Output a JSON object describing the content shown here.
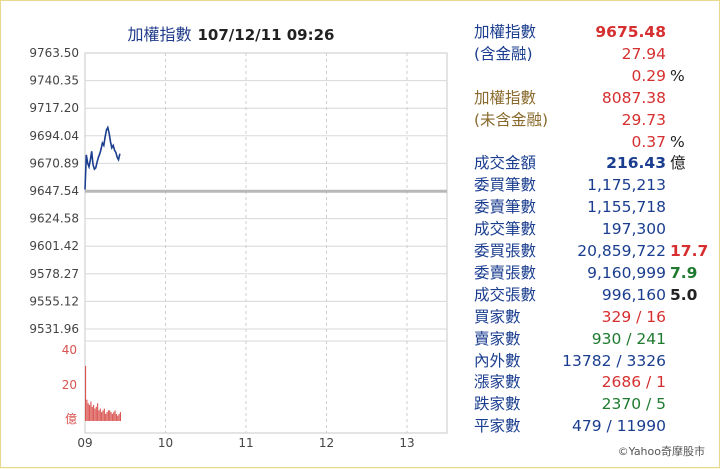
{
  "title": "加權指數",
  "datetime": "107/12/11 09:26",
  "copyright": "©Yahoo奇摩股市",
  "colors": {
    "line": "#1a3d8f",
    "ref": "#b8b8b8",
    "vol": "#d9534f",
    "red": "#d62f2f",
    "blue": "#1a3d8f",
    "green": "#1e7a2e",
    "brown": "#8a6a2c"
  },
  "yaxis": [
    "9763.50",
    "9740.35",
    "9717.20",
    "9694.04",
    "9670.89",
    "9647.54",
    "9624.58",
    "9601.42",
    "9578.27",
    "9555.12",
    "9531.96"
  ],
  "vol_axis": [
    "40",
    "20",
    "億"
  ],
  "xaxis": [
    "09",
    "10",
    "11",
    "12",
    "13"
  ],
  "stats": [
    {
      "label": "加權指數",
      "value": "9675.48",
      "suffix": "",
      "label_color": "#1a3d8f",
      "value_color": "#d62f2f",
      "bold": true
    },
    {
      "label": "(含金融)",
      "value": "27.94",
      "suffix": "",
      "label_color": "#1a3d8f",
      "value_color": "#d62f2f",
      "bold": false
    },
    {
      "label": "",
      "value": "0.29",
      "suffix": "%",
      "label_color": "#1a3d8f",
      "value_color": "#d62f2f",
      "bold": false
    },
    {
      "label": "加權指數",
      "value": "8087.38",
      "suffix": "",
      "label_color": "#8a6a2c",
      "value_color": "#d62f2f",
      "bold": false
    },
    {
      "label": "(未含金融)",
      "value": "29.73",
      "suffix": "",
      "label_color": "#8a6a2c",
      "value_color": "#d62f2f",
      "bold": false
    },
    {
      "label": "",
      "value": "0.37",
      "suffix": "%",
      "label_color": "#8a6a2c",
      "value_color": "#d62f2f",
      "bold": false
    },
    {
      "label": "成交金額",
      "value": "216.43",
      "suffix": "億",
      "label_color": "#1a3d8f",
      "value_color": "#1a3d8f",
      "bold": true
    },
    {
      "label": "委買筆數",
      "value": "1,175,213",
      "suffix": "",
      "label_color": "#1a3d8f",
      "value_color": "#1a3d8f",
      "bold": false
    },
    {
      "label": "委賣筆數",
      "value": "1,155,718",
      "suffix": "",
      "label_color": "#1a3d8f",
      "value_color": "#1a3d8f",
      "bold": false
    },
    {
      "label": "成交筆數",
      "value": "197,300",
      "suffix": "",
      "label_color": "#1a3d8f",
      "value_color": "#1a3d8f",
      "bold": false
    },
    {
      "label": "委買張數",
      "value": "20,859,722",
      "suffix": "17.7",
      "label_color": "#1a3d8f",
      "value_color": "#1a3d8f",
      "suffix_color": "#d62f2f",
      "bold": false
    },
    {
      "label": "委賣張數",
      "value": "9,160,999",
      "suffix": "7.9",
      "label_color": "#1a3d8f",
      "value_color": "#1a3d8f",
      "suffix_color": "#1e7a2e",
      "bold": false
    },
    {
      "label": "成交張數",
      "value": "996,160",
      "suffix": "5.0",
      "label_color": "#1a3d8f",
      "value_color": "#1a3d8f",
      "suffix_color": "#222222",
      "bold": false
    },
    {
      "label": "買家數",
      "value": "329 / 16",
      "suffix": "",
      "label_color": "#1a3d8f",
      "value_color": "#d62f2f",
      "bold": false
    },
    {
      "label": "賣家數",
      "value": "930 / 241",
      "suffix": "",
      "label_color": "#1a3d8f",
      "value_color": "#1e7a2e",
      "bold": false
    },
    {
      "label": "內外數",
      "value": "13782 / 3326",
      "suffix": "",
      "label_color": "#1a3d8f",
      "value_color": "#1a3d8f",
      "bold": false
    },
    {
      "label": "漲家數",
      "value": "2686 / 1",
      "suffix": "",
      "label_color": "#1a3d8f",
      "value_color": "#d62f2f",
      "bold": false
    },
    {
      "label": "跌家數",
      "value": "2370 / 5",
      "suffix": "",
      "label_color": "#1a3d8f",
      "value_color": "#1e7a2e",
      "bold": false
    },
    {
      "label": "平家數",
      "value": "479 / 11990",
      "suffix": "",
      "label_color": "#1a3d8f",
      "value_color": "#1a3d8f",
      "bold": false
    }
  ],
  "chart_data": {
    "type": "line",
    "reference": 9647.54,
    "ylim": [
      9531.96,
      9763.5
    ],
    "x_start": "09:00",
    "x_end": "13:30",
    "x": [
      "09:00",
      "09:01",
      "09:02",
      "09:03",
      "09:04",
      "09:05",
      "09:06",
      "09:07",
      "09:08",
      "09:09",
      "09:10",
      "09:11",
      "09:12",
      "09:13",
      "09:14",
      "09:15",
      "09:16",
      "09:17",
      "09:18",
      "09:19",
      "09:20",
      "09:21",
      "09:22",
      "09:23",
      "09:24",
      "09:25",
      "09:26"
    ],
    "values": [
      9649,
      9678,
      9671,
      9668,
      9674,
      9681,
      9670,
      9666,
      9667,
      9672,
      9676,
      9679,
      9683,
      9688,
      9686,
      9693,
      9699,
      9701,
      9696,
      9689,
      9684,
      9686,
      9682,
      9680,
      9676,
      9674,
      9679
    ],
    "volume": {
      "ylim": [
        0,
        40
      ],
      "values": [
        31,
        12,
        10,
        9,
        11,
        8,
        9,
        7,
        8,
        10,
        6,
        7,
        5,
        6,
        7,
        4,
        5,
        6,
        6,
        5,
        4,
        5,
        6,
        4,
        3,
        4,
        5
      ]
    }
  }
}
